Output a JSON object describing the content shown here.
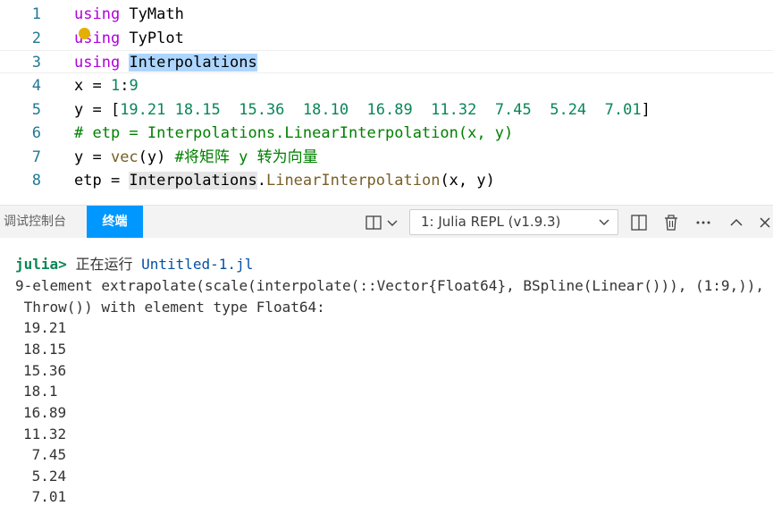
{
  "editor": {
    "lines": [
      {
        "n": "1",
        "tokens": [
          {
            "t": "using",
            "c": "kw"
          },
          {
            "t": " TyMath",
            "c": ""
          }
        ]
      },
      {
        "n": "2",
        "tokens": [
          {
            "t": "using",
            "c": "kw"
          },
          {
            "t": " TyPlot",
            "c": ""
          }
        ]
      },
      {
        "n": "3",
        "tokens": [
          {
            "t": "using",
            "c": "kw"
          },
          {
            "t": " ",
            "c": ""
          },
          {
            "t": "Interpolations",
            "c": "hl"
          }
        ]
      },
      {
        "n": "4",
        "tokens": [
          {
            "t": "x = ",
            "c": ""
          },
          {
            "t": "1",
            "c": "num"
          },
          {
            "t": ":",
            "c": ""
          },
          {
            "t": "9",
            "c": "num"
          }
        ]
      },
      {
        "n": "5",
        "tokens": [
          {
            "t": "y = [",
            "c": ""
          },
          {
            "t": "19.21 18.15  15.36  18.10  16.89  11.32  7.45  5.24  7.01",
            "c": "num"
          },
          {
            "t": "]",
            "c": ""
          }
        ]
      },
      {
        "n": "6",
        "tokens": [
          {
            "t": "# etp = Interpolations.LinearInterpolation(x, y)",
            "c": "cm"
          }
        ]
      },
      {
        "n": "7",
        "tokens": [
          {
            "t": "y = ",
            "c": ""
          },
          {
            "t": "vec",
            "c": "fn"
          },
          {
            "t": "(y) ",
            "c": ""
          },
          {
            "t": "#将矩阵 y 转为向量",
            "c": "cm"
          }
        ]
      },
      {
        "n": "8",
        "tokens": [
          {
            "t": "etp = ",
            "c": ""
          },
          {
            "t": "Interpolations",
            "c": "hl2"
          },
          {
            "t": ".",
            "c": ""
          },
          {
            "t": "LinearInterpolation",
            "c": "fn"
          },
          {
            "t": "(x, y)",
            "c": ""
          }
        ]
      }
    ]
  },
  "panel": {
    "tab_debug": "调试控制台",
    "tab_terminal": "终端",
    "terminal_select": "1: Julia REPL (v1.9.3)",
    "icons": [
      "split-layout-icon",
      "split-terminal-icon",
      "trash-icon",
      "more-icon",
      "chevron-up-icon",
      "close-icon"
    ]
  },
  "terminal": {
    "prompt": "julia>",
    "command": "正在运行",
    "file": "Untitled-1.jl",
    "output1": "9-element extrapolate(scale(interpolate(::Vector{Float64}, BSpline(Linear())), (1:9,)),",
    "output2": " Throw()) with element type Float64:",
    "values": [
      "19.21",
      "18.15",
      "15.36",
      "18.1",
      "16.89",
      "11.32",
      " 7.45",
      " 5.24",
      " 7.01"
    ]
  },
  "colors": {
    "keyword": "#af00db",
    "number": "#098658",
    "comment": "#008000",
    "function": "#795e26",
    "accent": "#0098ff"
  }
}
